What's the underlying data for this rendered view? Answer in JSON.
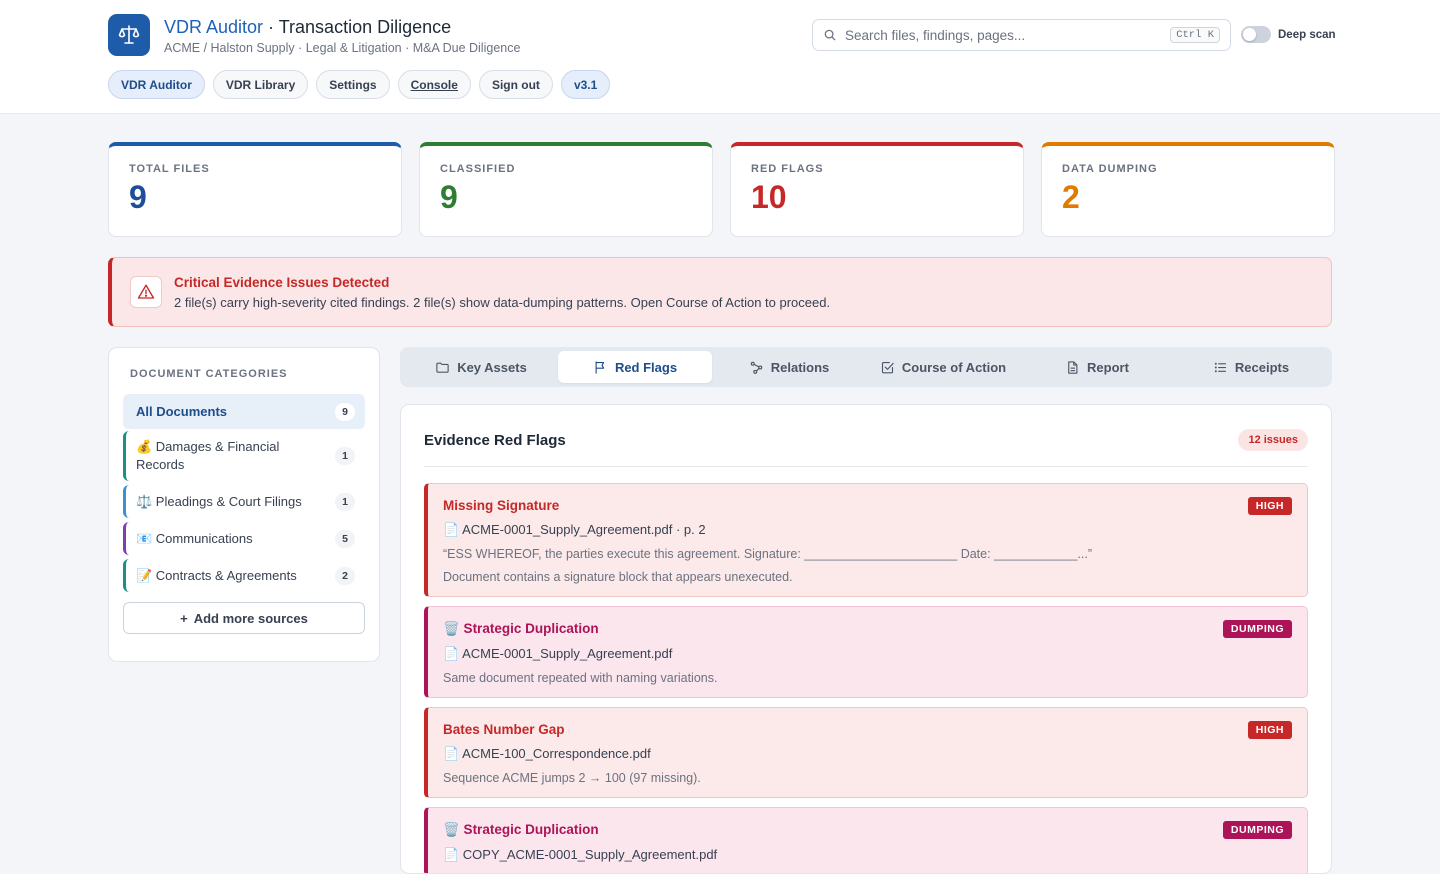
{
  "header": {
    "app_name": "VDR Auditor",
    "separator": " · ",
    "page_title": "Transaction Diligence",
    "subtitle": "ACME / Halston Supply · Legal & Litigation · M&A Due Diligence",
    "search_placeholder": "Search files, findings, pages...",
    "search_shortcut": "Ctrl K",
    "deep_scan_label": "Deep scan",
    "deep_scan_on": false
  },
  "nav": {
    "items": [
      {
        "label": "VDR Auditor"
      },
      {
        "label": "VDR Library"
      },
      {
        "label": "Settings"
      },
      {
        "label": "Console"
      },
      {
        "label": "Sign out"
      },
      {
        "label": "v3.1"
      }
    ]
  },
  "stats": [
    {
      "label": "TOTAL FILES",
      "value": "9",
      "color": "#1e4d9a"
    },
    {
      "label": "CLASSIFIED",
      "value": "9",
      "color": "#2e7d32"
    },
    {
      "label": "RED FLAGS",
      "value": "10",
      "color": "#c62828"
    },
    {
      "label": "DATA DUMPING",
      "value": "2",
      "color": "#e07b00"
    }
  ],
  "alert": {
    "title": "Critical Evidence Issues Detected",
    "message": "2 file(s) carry high-severity cited findings. 2 file(s) show data-dumping patterns. Open Course of Action to proceed."
  },
  "sidebar": {
    "heading": "DOCUMENT CATEGORIES",
    "all": {
      "label": "All Documents",
      "count": "9"
    },
    "categories": [
      {
        "label": "💰 Damages & Financial Records",
        "count": "1",
        "color": "#1a8f86"
      },
      {
        "label": "⚖️ Pleadings & Court Filings",
        "count": "1",
        "color": "#3b8fd4"
      },
      {
        "label": "📧 Communications",
        "count": "5",
        "color": "#7b3fb5"
      },
      {
        "label": "📝 Contracts & Agreements",
        "count": "2",
        "color": "#1a8f86"
      }
    ],
    "add_button": "Add more sources"
  },
  "tabs": [
    {
      "label": "Key Assets",
      "icon": "folder-icon"
    },
    {
      "label": "Red Flags",
      "icon": "flag-icon"
    },
    {
      "label": "Relations",
      "icon": "share-icon"
    },
    {
      "label": "Course of Action",
      "icon": "check-square-icon"
    },
    {
      "label": "Report",
      "icon": "document-icon"
    },
    {
      "label": "Receipts",
      "icon": "list-icon"
    }
  ],
  "active_tab": "Red Flags",
  "panel": {
    "title": "Evidence Red Flags",
    "issues": "12 issues",
    "flags": [
      {
        "severity": "high",
        "title": "Missing Signature",
        "badge": "HIGH",
        "file": "📄 ACME-0001_Supply_Agreement.pdf · p. 2",
        "quote": "“ESS WHEREOF, the parties execute this agreement. Signature: ______________________ Date: ____________...”",
        "description": "Document contains a signature block that appears unexecuted."
      },
      {
        "severity": "dump",
        "title": "🗑️ Strategic Duplication",
        "badge": "DUMPING",
        "file": "📄 ACME-0001_Supply_Agreement.pdf",
        "quote": "",
        "description": "Same document repeated with naming variations."
      },
      {
        "severity": "high",
        "title": "Bates Number Gap",
        "badge": "HIGH",
        "file": "📄 ACME-100_Correspondence.pdf",
        "quote": "",
        "description": "Sequence ACME jumps 2 → 100 (97 missing)."
      },
      {
        "severity": "dump",
        "title": "🗑️ Strategic Duplication",
        "badge": "DUMPING",
        "file": "📄 COPY_ACME-0001_Supply_Agreement.pdf",
        "quote": "",
        "description": ""
      }
    ]
  }
}
